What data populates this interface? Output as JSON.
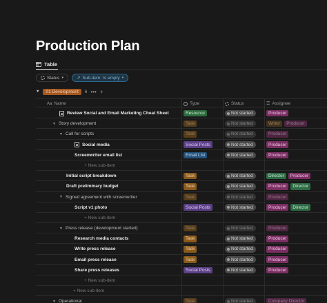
{
  "page": {
    "title": "Production Plan"
  },
  "views": {
    "tab_table": "Table"
  },
  "filters": {
    "status": "Status",
    "subitem": "Sub-item: Is empty"
  },
  "group": {
    "label": "01 Development",
    "count": "6",
    "more": "•••",
    "add": "+"
  },
  "columns": {
    "name": "Name",
    "type": "Type",
    "status": "Status",
    "assignee": "Assignee"
  },
  "colors": {
    "Resource": [
      "#2d6a3d",
      "#c9ecd2"
    ],
    "Task": [
      "#8a5a1c",
      "#f3d6b0"
    ],
    "Social Posts": [
      "#5b3f86",
      "#e0cff5"
    ],
    "Email List": [
      "#24517a",
      "#c8e0f4"
    ],
    "Producer": [
      "#7a2f63",
      "#f3c9e5"
    ],
    "Writer": [
      "#6a4a1e",
      "#f0d2a4"
    ],
    "Director": [
      "#2e6b45",
      "#cdebd6"
    ],
    "Company Director": [
      "#7a2f63",
      "#f3c9e5"
    ]
  },
  "rows": [
    {
      "name": "Review Social and Email Marketing Cheat Sheet",
      "indent": 10,
      "icon": "doc",
      "style": "bold",
      "type": "Resource",
      "status": "Not started",
      "assignees": [
        "Producer"
      ]
    },
    {
      "name": "Story development",
      "indent": 0,
      "icon": "chev",
      "style": "normal",
      "type": "Task",
      "status": "Not started",
      "assignees": [
        "Writer",
        "Producer"
      ],
      "dim": true
    },
    {
      "name": "Call for scripts",
      "indent": 10,
      "icon": "chev",
      "style": "normal",
      "type": "Task",
      "status": "Not started",
      "assignees": [
        "Producer"
      ],
      "dim": true
    },
    {
      "name": "Social media",
      "indent": 32,
      "icon": "doc",
      "style": "bold",
      "type": "Social Posts",
      "status": "Not started",
      "assignees": [
        "Producer"
      ]
    },
    {
      "name": "Screenwriter email list",
      "indent": 32,
      "icon": "none",
      "style": "bold",
      "type": "Email List",
      "status": "Not started",
      "assignees": [
        "Producer"
      ]
    },
    {
      "name": "+ New sub-item",
      "indent": 46,
      "icon": "none",
      "style": "muted"
    },
    {
      "name": "Initial script breakdown",
      "indent": 20,
      "icon": "none",
      "style": "bold",
      "type": "Task",
      "status": "Not started",
      "assignees": [
        "Director",
        "Producer"
      ]
    },
    {
      "name": "Draft preliminary budget",
      "indent": 20,
      "icon": "none",
      "style": "bold",
      "type": "Task",
      "status": "Not started",
      "assignees": [
        "Producer",
        "Director"
      ]
    },
    {
      "name": "Signed agreement with screenwriter",
      "indent": 10,
      "icon": "chev",
      "style": "normal",
      "type": "Task",
      "status": "Not started",
      "assignees": [
        "Producer"
      ],
      "dim": true
    },
    {
      "name": "Script v1 photo",
      "indent": 32,
      "icon": "none",
      "style": "bold",
      "type": "Social Posts",
      "status": "Not started",
      "assignees": [
        "Producer",
        "Director"
      ]
    },
    {
      "name": "+ New sub-item",
      "indent": 46,
      "icon": "none",
      "style": "muted"
    },
    {
      "name": "Press release (development started)",
      "indent": 10,
      "icon": "chev",
      "style": "normal",
      "type": "Task",
      "status": "Not started",
      "assignees": [
        "Producer"
      ],
      "dim": true
    },
    {
      "name": "Research media contacts",
      "indent": 32,
      "icon": "none",
      "style": "bold",
      "type": "Task",
      "status": "Not started",
      "assignees": [
        "Producer"
      ]
    },
    {
      "name": "Write press release",
      "indent": 32,
      "icon": "none",
      "style": "bold",
      "type": "Task",
      "status": "Not started",
      "assignees": [
        "Producer"
      ]
    },
    {
      "name": "Email press release",
      "indent": 32,
      "icon": "none",
      "style": "bold",
      "type": "Task",
      "status": "Not started",
      "assignees": [
        "Producer"
      ]
    },
    {
      "name": "Share press releases",
      "indent": 32,
      "icon": "none",
      "style": "bold",
      "type": "Social Posts",
      "status": "Not started",
      "assignees": [
        "Producer"
      ]
    },
    {
      "name": "+ New sub-item",
      "indent": 46,
      "icon": "none",
      "style": "muted"
    },
    {
      "name": "+ New sub-item",
      "indent": 30,
      "icon": "none",
      "style": "muted"
    },
    {
      "name": "Operational",
      "indent": 0,
      "icon": "chev",
      "style": "normal",
      "type": "Task",
      "status": "Not started",
      "assignees": [
        "Company Director"
      ],
      "dim": true
    }
  ]
}
